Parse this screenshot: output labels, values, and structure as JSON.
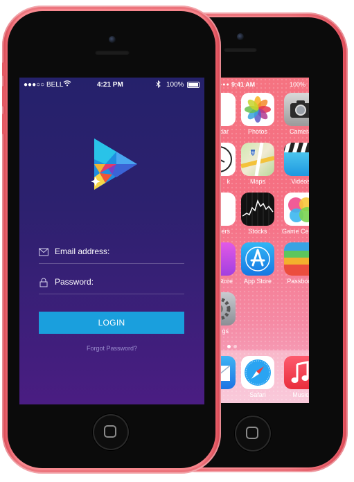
{
  "back_phone": {
    "status": {
      "time": "9:41 AM",
      "battery": "100%"
    },
    "apps": [
      {
        "label": "Calendar",
        "visible_label": "dar",
        "icon": "calendar-icon"
      },
      {
        "label": "Photos",
        "icon": "photos-icon"
      },
      {
        "label": "Camera",
        "icon": "camera-icon"
      },
      {
        "label": "Clock",
        "visible_label": "k",
        "icon": "clock-icon"
      },
      {
        "label": "Maps",
        "icon": "maps-icon"
      },
      {
        "label": "Videos",
        "icon": "videos-icon"
      },
      {
        "label": "Reminders",
        "visible_label": "ders",
        "icon": "reminders-icon"
      },
      {
        "label": "Stocks",
        "icon": "stocks-icon"
      },
      {
        "label": "Game Center",
        "icon": "game-center-icon"
      },
      {
        "label": "iTunes Store",
        "visible_label": "Store",
        "icon": "itunes-store-icon"
      },
      {
        "label": "App Store",
        "icon": "app-store-icon"
      },
      {
        "label": "Passbook",
        "icon": "passbook-icon"
      },
      {
        "label": "Settings",
        "visible_label": "gs",
        "icon": "settings-icon"
      }
    ],
    "dock": [
      {
        "label": "Mail",
        "icon": "mail-icon"
      },
      {
        "label": "Safari",
        "icon": "safari-icon"
      },
      {
        "label": "Music",
        "icon": "music-icon"
      }
    ],
    "maps_shield": "280"
  },
  "front_phone": {
    "status": {
      "carrier": "●●●○○ BELL",
      "time": "4:21 PM",
      "battery": "100%"
    },
    "email_label": "Email address:",
    "password_label": "Password:",
    "login_label": "LOGIN",
    "forgot_label": "Forgot Password?"
  },
  "colors": {
    "login_button": "#1a9fdd",
    "screen_top": "#25216b",
    "screen_bottom": "#4a1d82",
    "phone_body": "#f7858c"
  }
}
